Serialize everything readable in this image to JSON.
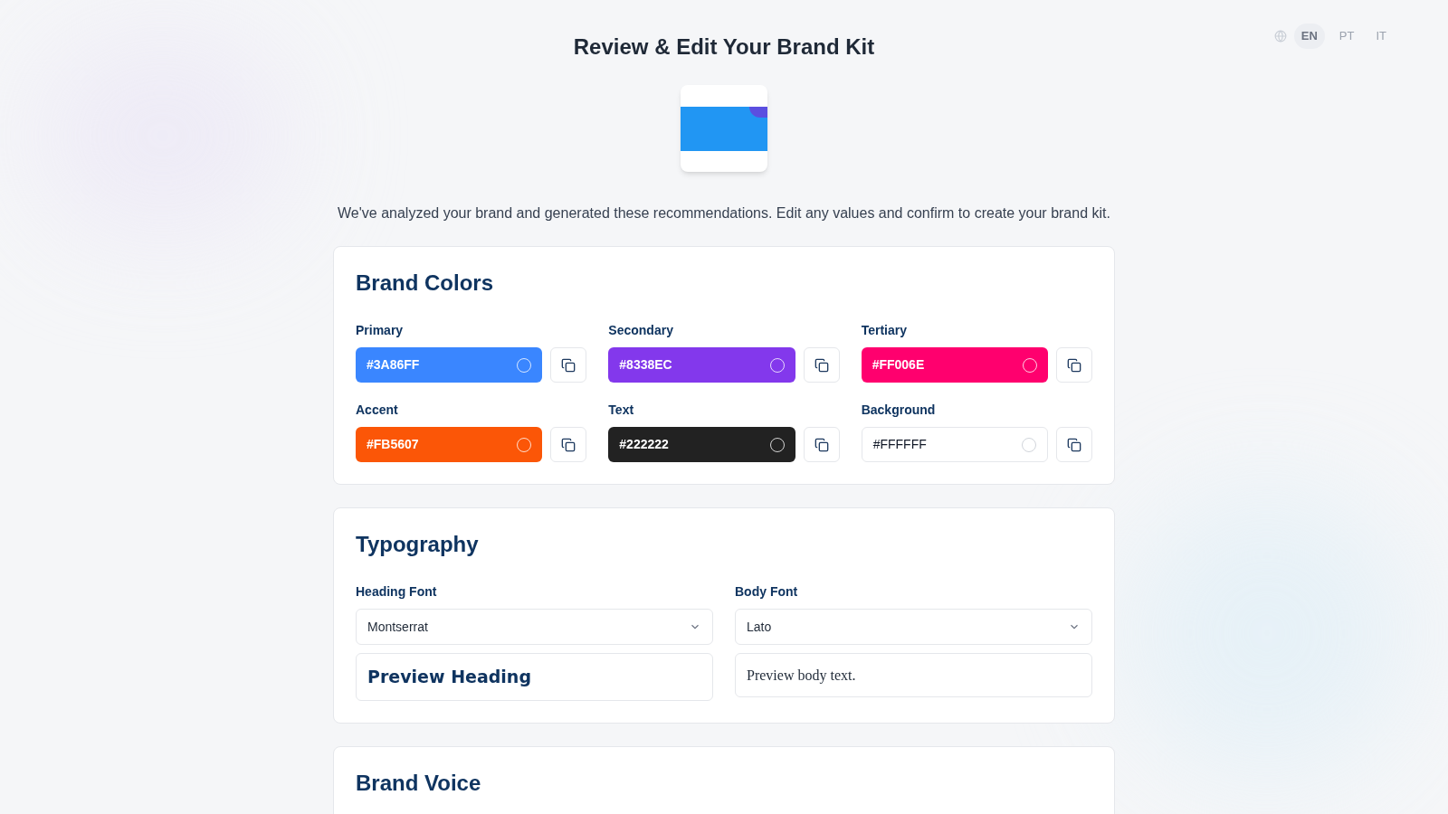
{
  "languages": [
    {
      "label": "EN",
      "selected": true
    },
    {
      "label": "PT",
      "selected": false
    },
    {
      "label": "IT",
      "selected": false
    }
  ],
  "title": "Review & Edit Your Brand Kit",
  "description": "We've analyzed your brand and generated these recommendations. Edit any values and confirm to create your brand kit.",
  "brand_colors": {
    "title": "Brand Colors",
    "items": [
      {
        "label": "Primary",
        "value": "#3A86FF",
        "color": "#3a86ff"
      },
      {
        "label": "Secondary",
        "value": "#8338EC",
        "color": "#8338ec"
      },
      {
        "label": "Tertiary",
        "value": "#FF006E",
        "color": "#ff006e"
      },
      {
        "label": "Accent",
        "value": "#FB5607",
        "color": "#fb5607"
      },
      {
        "label": "Text",
        "value": "#222222",
        "color": "#222222"
      },
      {
        "label": "Background",
        "value": "#FFFFFF",
        "color": "#ffffff"
      }
    ]
  },
  "typography": {
    "title": "Typography",
    "fields": [
      {
        "kind": "heading",
        "label": "Heading Font",
        "value": "Montserrat",
        "preview": "Preview Heading"
      },
      {
        "kind": "body",
        "label": "Body Font",
        "value": "Lato",
        "preview": "Preview body text."
      }
    ]
  },
  "brand_voice": {
    "title": "Brand Voice"
  }
}
